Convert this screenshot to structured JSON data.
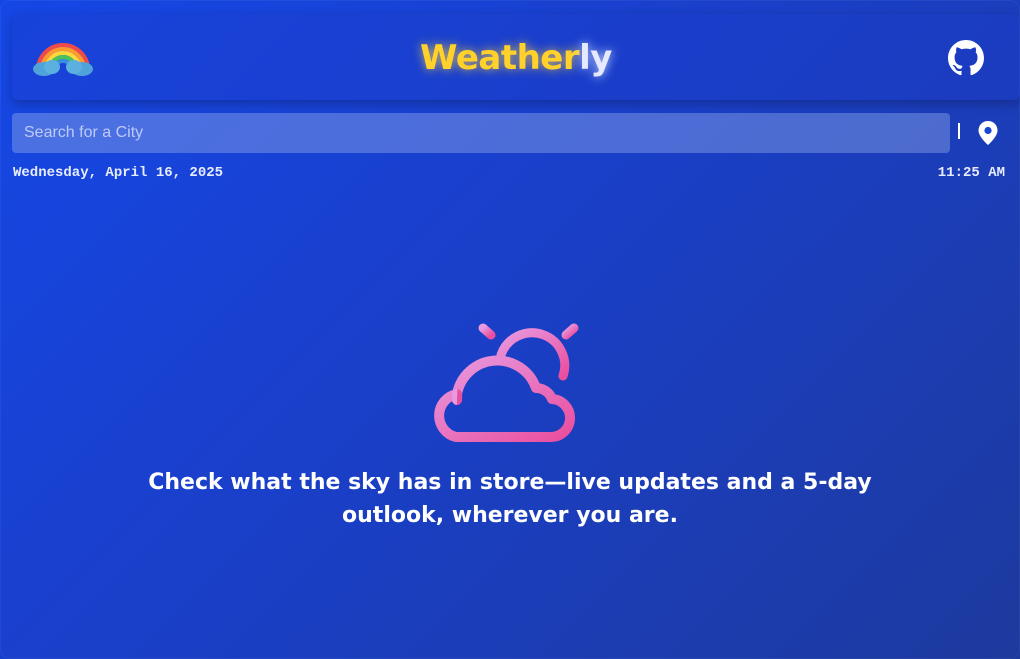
{
  "app": {
    "title_part1": "Weather",
    "title_part2": "ly"
  },
  "header": {
    "logo_icon": "rainbow-icon",
    "github_icon": "github-icon"
  },
  "search": {
    "placeholder": "Search for a City",
    "value": "",
    "separator": "|",
    "location_icon": "map-pin-icon"
  },
  "datetime": {
    "date": "Wednesday, April 16, 2025",
    "time": "11:25 AM"
  },
  "hero": {
    "icon": "partly-cloudy-icon",
    "tagline": "Check what the sky has in store—live updates and a 5-day outlook, wherever you are."
  },
  "colors": {
    "background_start": "#1547e6",
    "background_end": "#1d3a9e",
    "brand_yellow": "#ffd12a",
    "brand_light": "#e4e9ff",
    "icon_pink": "#ec5aa8"
  }
}
